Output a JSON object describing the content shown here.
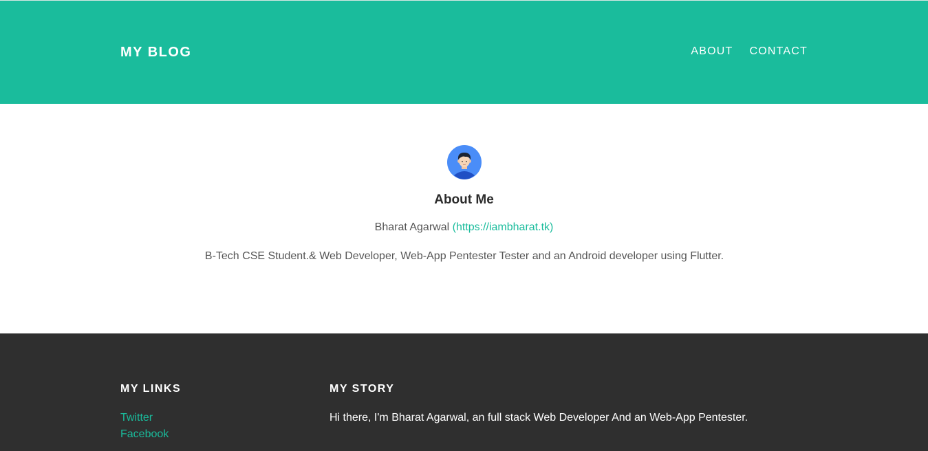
{
  "header": {
    "brand": "MY BLOG",
    "nav": [
      {
        "label": "ABOUT"
      },
      {
        "label": "CONTACT"
      }
    ]
  },
  "about": {
    "avatar_icon": "user-avatar-icon",
    "title": "About Me",
    "author_name": "Bharat Agarwal",
    "author_link": "(https://iambharat.tk)",
    "bio": "B-Tech CSE Student.& Web Developer, Web-App Pentester Tester and an Android developer using Flutter."
  },
  "footer": {
    "links_title": "MY LINKS",
    "links": [
      {
        "label": "Twitter"
      },
      {
        "label": "Facebook"
      }
    ],
    "story_title": "MY STORY",
    "story_text": "Hi there, I'm Bharat Agarwal, an full stack Web Developer And an Web-App Pentester."
  },
  "colors": {
    "accent": "#1abc9c",
    "footer_bg": "#2f2f2f",
    "avatar_bg": "#4a8df8"
  }
}
